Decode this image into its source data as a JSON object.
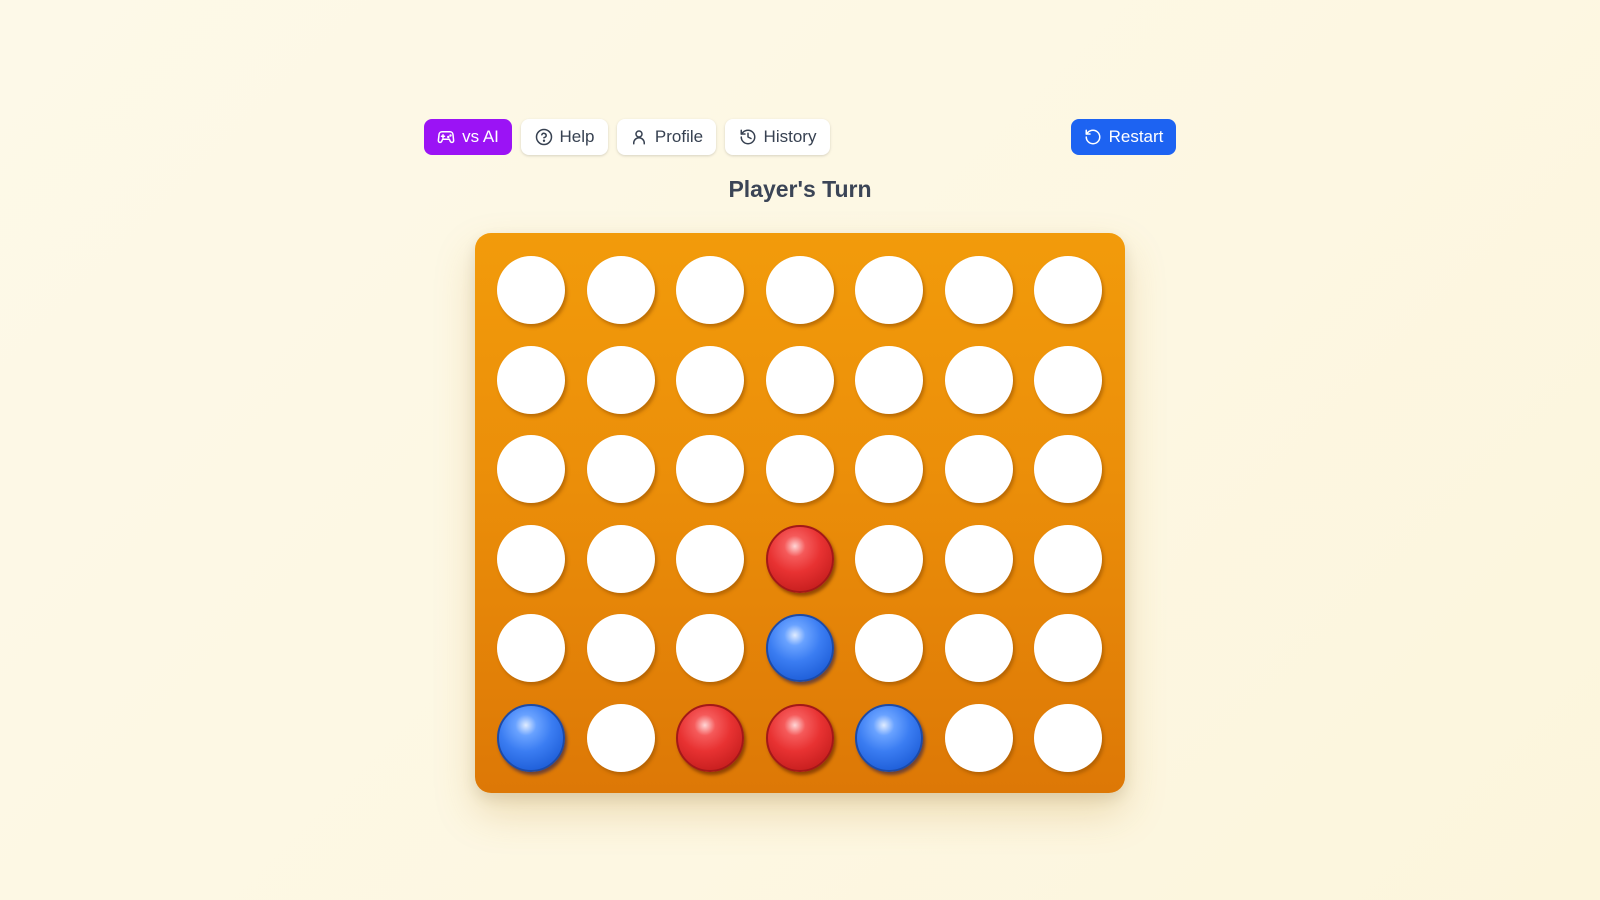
{
  "toolbar": {
    "mode_label": "vs AI",
    "help_label": "Help",
    "profile_label": "Profile",
    "history_label": "History",
    "restart_label": "Restart"
  },
  "status": {
    "turn_text": "Player's Turn"
  },
  "icons": {
    "mode": "gamepad-icon",
    "help": "help-circle-icon",
    "profile": "user-icon",
    "history": "history-icon",
    "restart": "restart-icon"
  },
  "colors": {
    "mode_button": "#9b13f5",
    "restart_button": "#1d63f2",
    "board": "#f29b0b",
    "red_piece": "#e83232",
    "blue_piece": "#3b7df2",
    "empty_slot": "#ffffff"
  },
  "board": {
    "columns": 7,
    "rows": 6,
    "grid": [
      [
        "empty",
        "empty",
        "empty",
        "empty",
        "empty",
        "empty",
        "empty"
      ],
      [
        "empty",
        "empty",
        "empty",
        "empty",
        "empty",
        "empty",
        "empty"
      ],
      [
        "empty",
        "empty",
        "empty",
        "empty",
        "empty",
        "empty",
        "empty"
      ],
      [
        "empty",
        "empty",
        "empty",
        "red",
        "empty",
        "empty",
        "empty"
      ],
      [
        "empty",
        "empty",
        "empty",
        "blue",
        "empty",
        "empty",
        "empty"
      ],
      [
        "blue",
        "empty",
        "red",
        "red",
        "blue",
        "empty",
        "empty"
      ]
    ]
  }
}
